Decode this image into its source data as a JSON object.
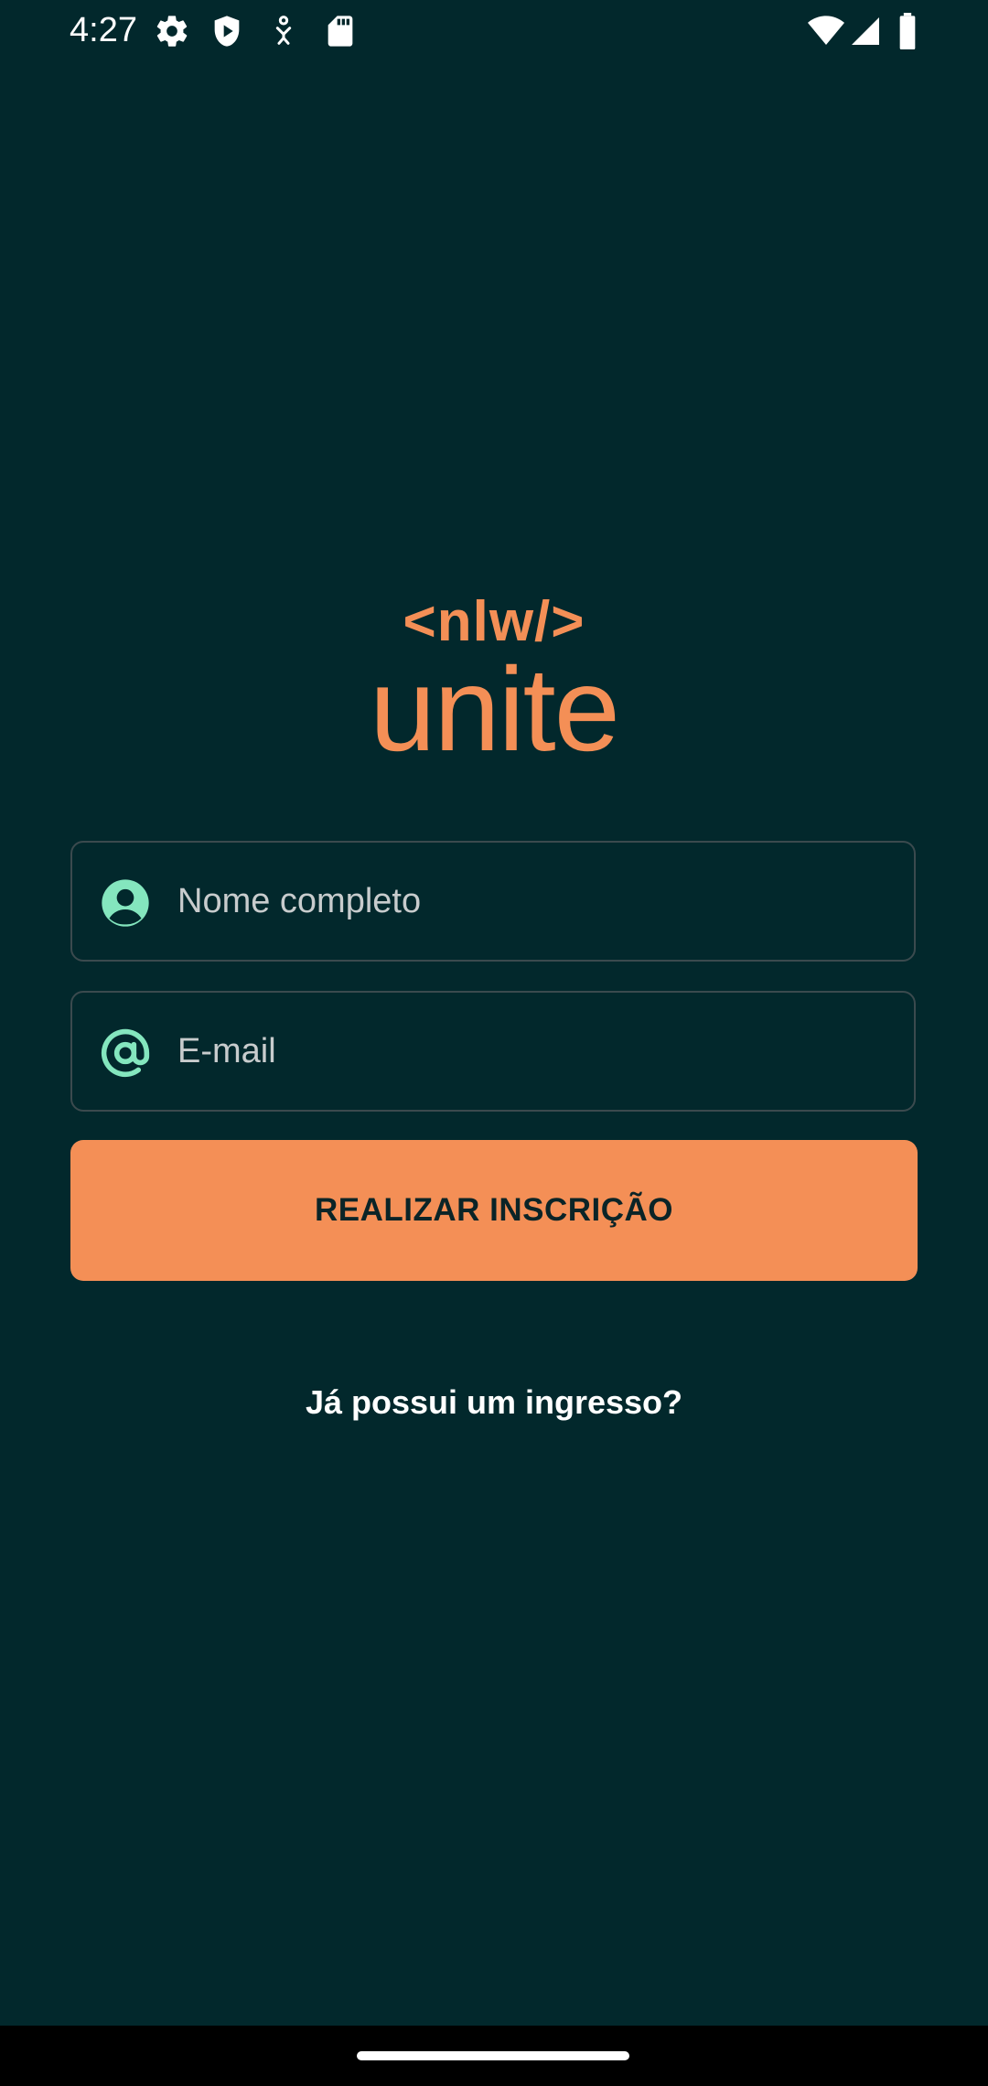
{
  "status_bar": {
    "time": "4:27",
    "left_icons": [
      "settings-gear-icon",
      "play-protect-icon",
      "accessibility-icon",
      "sd-card-icon"
    ],
    "right_icons": [
      "wifi-icon",
      "signal-icon",
      "battery-icon"
    ]
  },
  "logo": {
    "top_text": "<nlw/>",
    "main_text": "unite",
    "color": "#f48f56"
  },
  "form": {
    "name_field": {
      "placeholder": "Nome completo",
      "value": "",
      "icon": "user-circle-icon"
    },
    "email_field": {
      "placeholder": "E-mail",
      "value": "",
      "icon": "at-sign-icon"
    },
    "submit_label": "REALIZAR INSCRIÇÃO"
  },
  "link": {
    "label": "Já possui um ingresso?"
  },
  "colors": {
    "background": "#02282c",
    "accent": "#f48f56",
    "icon_green": "#84e6be",
    "input_border": "#3b4a4e"
  }
}
